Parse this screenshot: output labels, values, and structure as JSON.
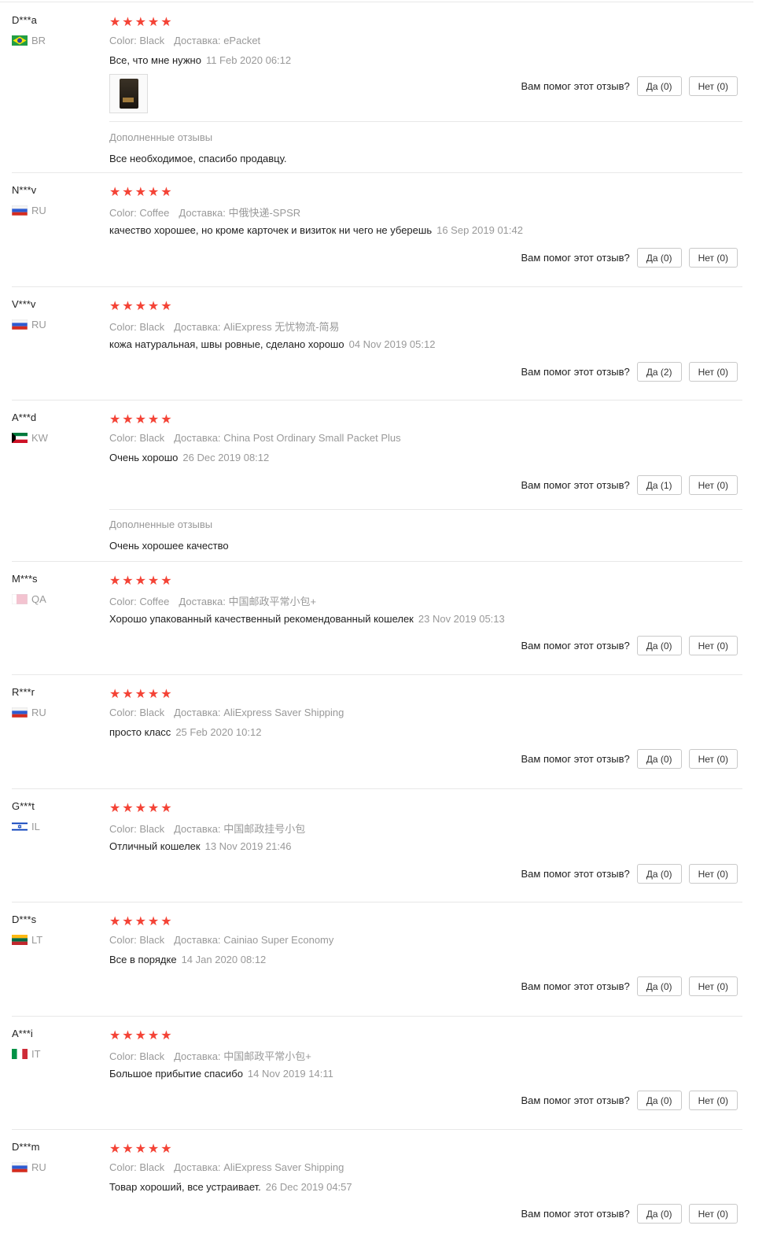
{
  "helpful_question": "Вам помог этот отзыв?",
  "followup_title": "Дополненные отзывы",
  "labels": {
    "color": "Color:",
    "delivery": "Доставка:"
  },
  "reviews": [
    {
      "user": "D***a",
      "country": "BR",
      "color": "Black",
      "delivery": "ePacket",
      "text": "Все, что мне нужно",
      "date": "11 Feb 2020 06:12",
      "yes": "Да (0)",
      "no": "Нет (0)",
      "rating": 5,
      "has_photo": true,
      "followup": "Все необходимое, спасибо продавцу."
    },
    {
      "user": "N***v",
      "country": "RU",
      "color": "Coffee",
      "delivery": "中俄快递-SPSR",
      "text": "качество хорошее, но кроме карточек и визиток ни чего не уберешь",
      "date": "16 Sep 2019 01:42",
      "yes": "Да (0)",
      "no": "Нет (0)",
      "rating": 5
    },
    {
      "user": "V***v",
      "country": "RU",
      "color": "Black",
      "delivery": "AliExpress 无忧物流-简易",
      "text": "кожа натуральная, швы ровные, сделано хорошо",
      "date": "04 Nov 2019 05:12",
      "yes": "Да (2)",
      "no": "Нет (0)",
      "rating": 5
    },
    {
      "user": "A***d",
      "country": "KW",
      "color": "Black",
      "delivery": "China Post Ordinary Small Packet Plus",
      "text": "Очень хорошо",
      "date": "26 Dec 2019 08:12",
      "yes": "Да (1)",
      "no": "Нет (0)",
      "rating": 5,
      "followup": "Очень хорошее качество"
    },
    {
      "user": "M***s",
      "country": "QA",
      "color": "Coffee",
      "delivery": "中国邮政平常小包+",
      "text": "Хорошо упакованный качественный рекомендованный кошелек",
      "date": "23 Nov 2019 05:13",
      "yes": "Да (0)",
      "no": "Нет (0)",
      "rating": 5
    },
    {
      "user": "R***r",
      "country": "RU",
      "color": "Black",
      "delivery": "AliExpress Saver Shipping",
      "text": "просто класс",
      "date": "25 Feb 2020 10:12",
      "yes": "Да (0)",
      "no": "Нет (0)",
      "rating": 5
    },
    {
      "user": "G***t",
      "country": "IL",
      "color": "Black",
      "delivery": "中国邮政挂号小包",
      "text": "Отличный кошелек",
      "date": "13 Nov 2019 21:46",
      "yes": "Да (0)",
      "no": "Нет (0)",
      "rating": 5
    },
    {
      "user": "D***s",
      "country": "LT",
      "color": "Black",
      "delivery": "Cainiao Super Economy",
      "text": "Все в порядке",
      "date": "14 Jan 2020 08:12",
      "yes": "Да (0)",
      "no": "Нет (0)",
      "rating": 5
    },
    {
      "user": "A***i",
      "country": "IT",
      "color": "Black",
      "delivery": "中国邮政平常小包+",
      "text": "Большое прибытие спасибо",
      "date": "14 Nov 2019 14:11",
      "yes": "Да (0)",
      "no": "Нет (0)",
      "rating": 5
    },
    {
      "user": "D***m",
      "country": "RU",
      "color": "Black",
      "delivery": "AliExpress Saver Shipping",
      "text": "Товар хороший, все устраивает.",
      "date": "26 Dec 2019 04:57",
      "yes": "Да (0)",
      "no": "Нет (0)",
      "rating": 5
    }
  ]
}
